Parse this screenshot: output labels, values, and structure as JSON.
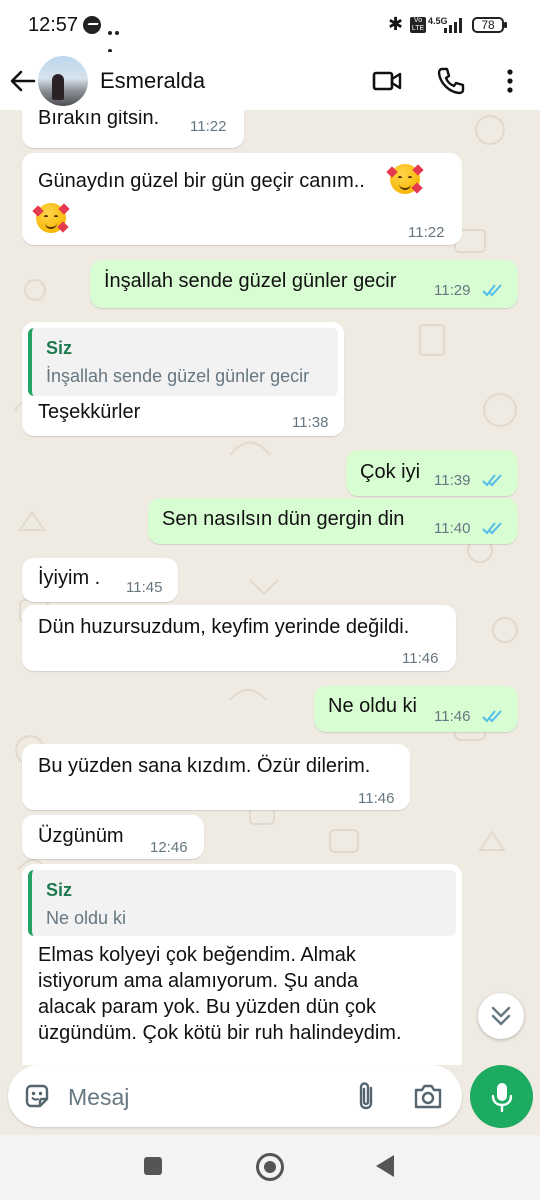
{
  "status_bar": {
    "time": "12:57",
    "network": "4.5G",
    "battery": "78"
  },
  "header": {
    "contact_name": "Esmeralda"
  },
  "messages": [
    {
      "dir": "in",
      "text": "Bırakın gitsin.",
      "time": "11:22"
    },
    {
      "dir": "in",
      "text": "Günaydın güzel bir gün geçir canım..",
      "time": "11:22"
    },
    {
      "dir": "out",
      "text": "İnşallah sende güzel günler gecir",
      "time": "11:29"
    },
    {
      "dir": "in",
      "quote_author": "Siz",
      "quote_text": "İnşallah sende güzel günler gecir",
      "text": "Teşekkürler",
      "time": "11:38"
    },
    {
      "dir": "out",
      "text": "Çok iyi",
      "time": "11:39"
    },
    {
      "dir": "out",
      "text": "Sen nasılsın dün gergin din",
      "time": "11:40"
    },
    {
      "dir": "in",
      "text": "İyiyim .",
      "time": "11:45"
    },
    {
      "dir": "in",
      "text": "Dün huzursuzdum, keyfim yerinde değildi.",
      "time": "11:46"
    },
    {
      "dir": "out",
      "text": "Ne oldu ki",
      "time": "11:46"
    },
    {
      "dir": "in",
      "text": "Bu yüzden sana kızdım. Özür dilerim.",
      "time": "11:46"
    },
    {
      "dir": "in",
      "text": "Üzgünüm",
      "time": "12:46"
    },
    {
      "dir": "in",
      "quote_author": "Siz",
      "quote_text": "Ne oldu ki",
      "lines": [
        "Elmas kolyeyi çok beğendim. Almak",
        "istiyorum ama alamıyorum. Şu anda",
        "alacak param yok. Bu yüzden dün çok",
        "üzgündüm. Çok kötü bir ruh halindeydim."
      ]
    }
  ],
  "composer": {
    "placeholder": "Mesaj"
  },
  "colors": {
    "accent": "#1daa61",
    "outgoing": "#d9fdd3",
    "incoming": "#ffffff",
    "read_ticks": "#53bdeb",
    "chat_bg": "#efeae2"
  }
}
